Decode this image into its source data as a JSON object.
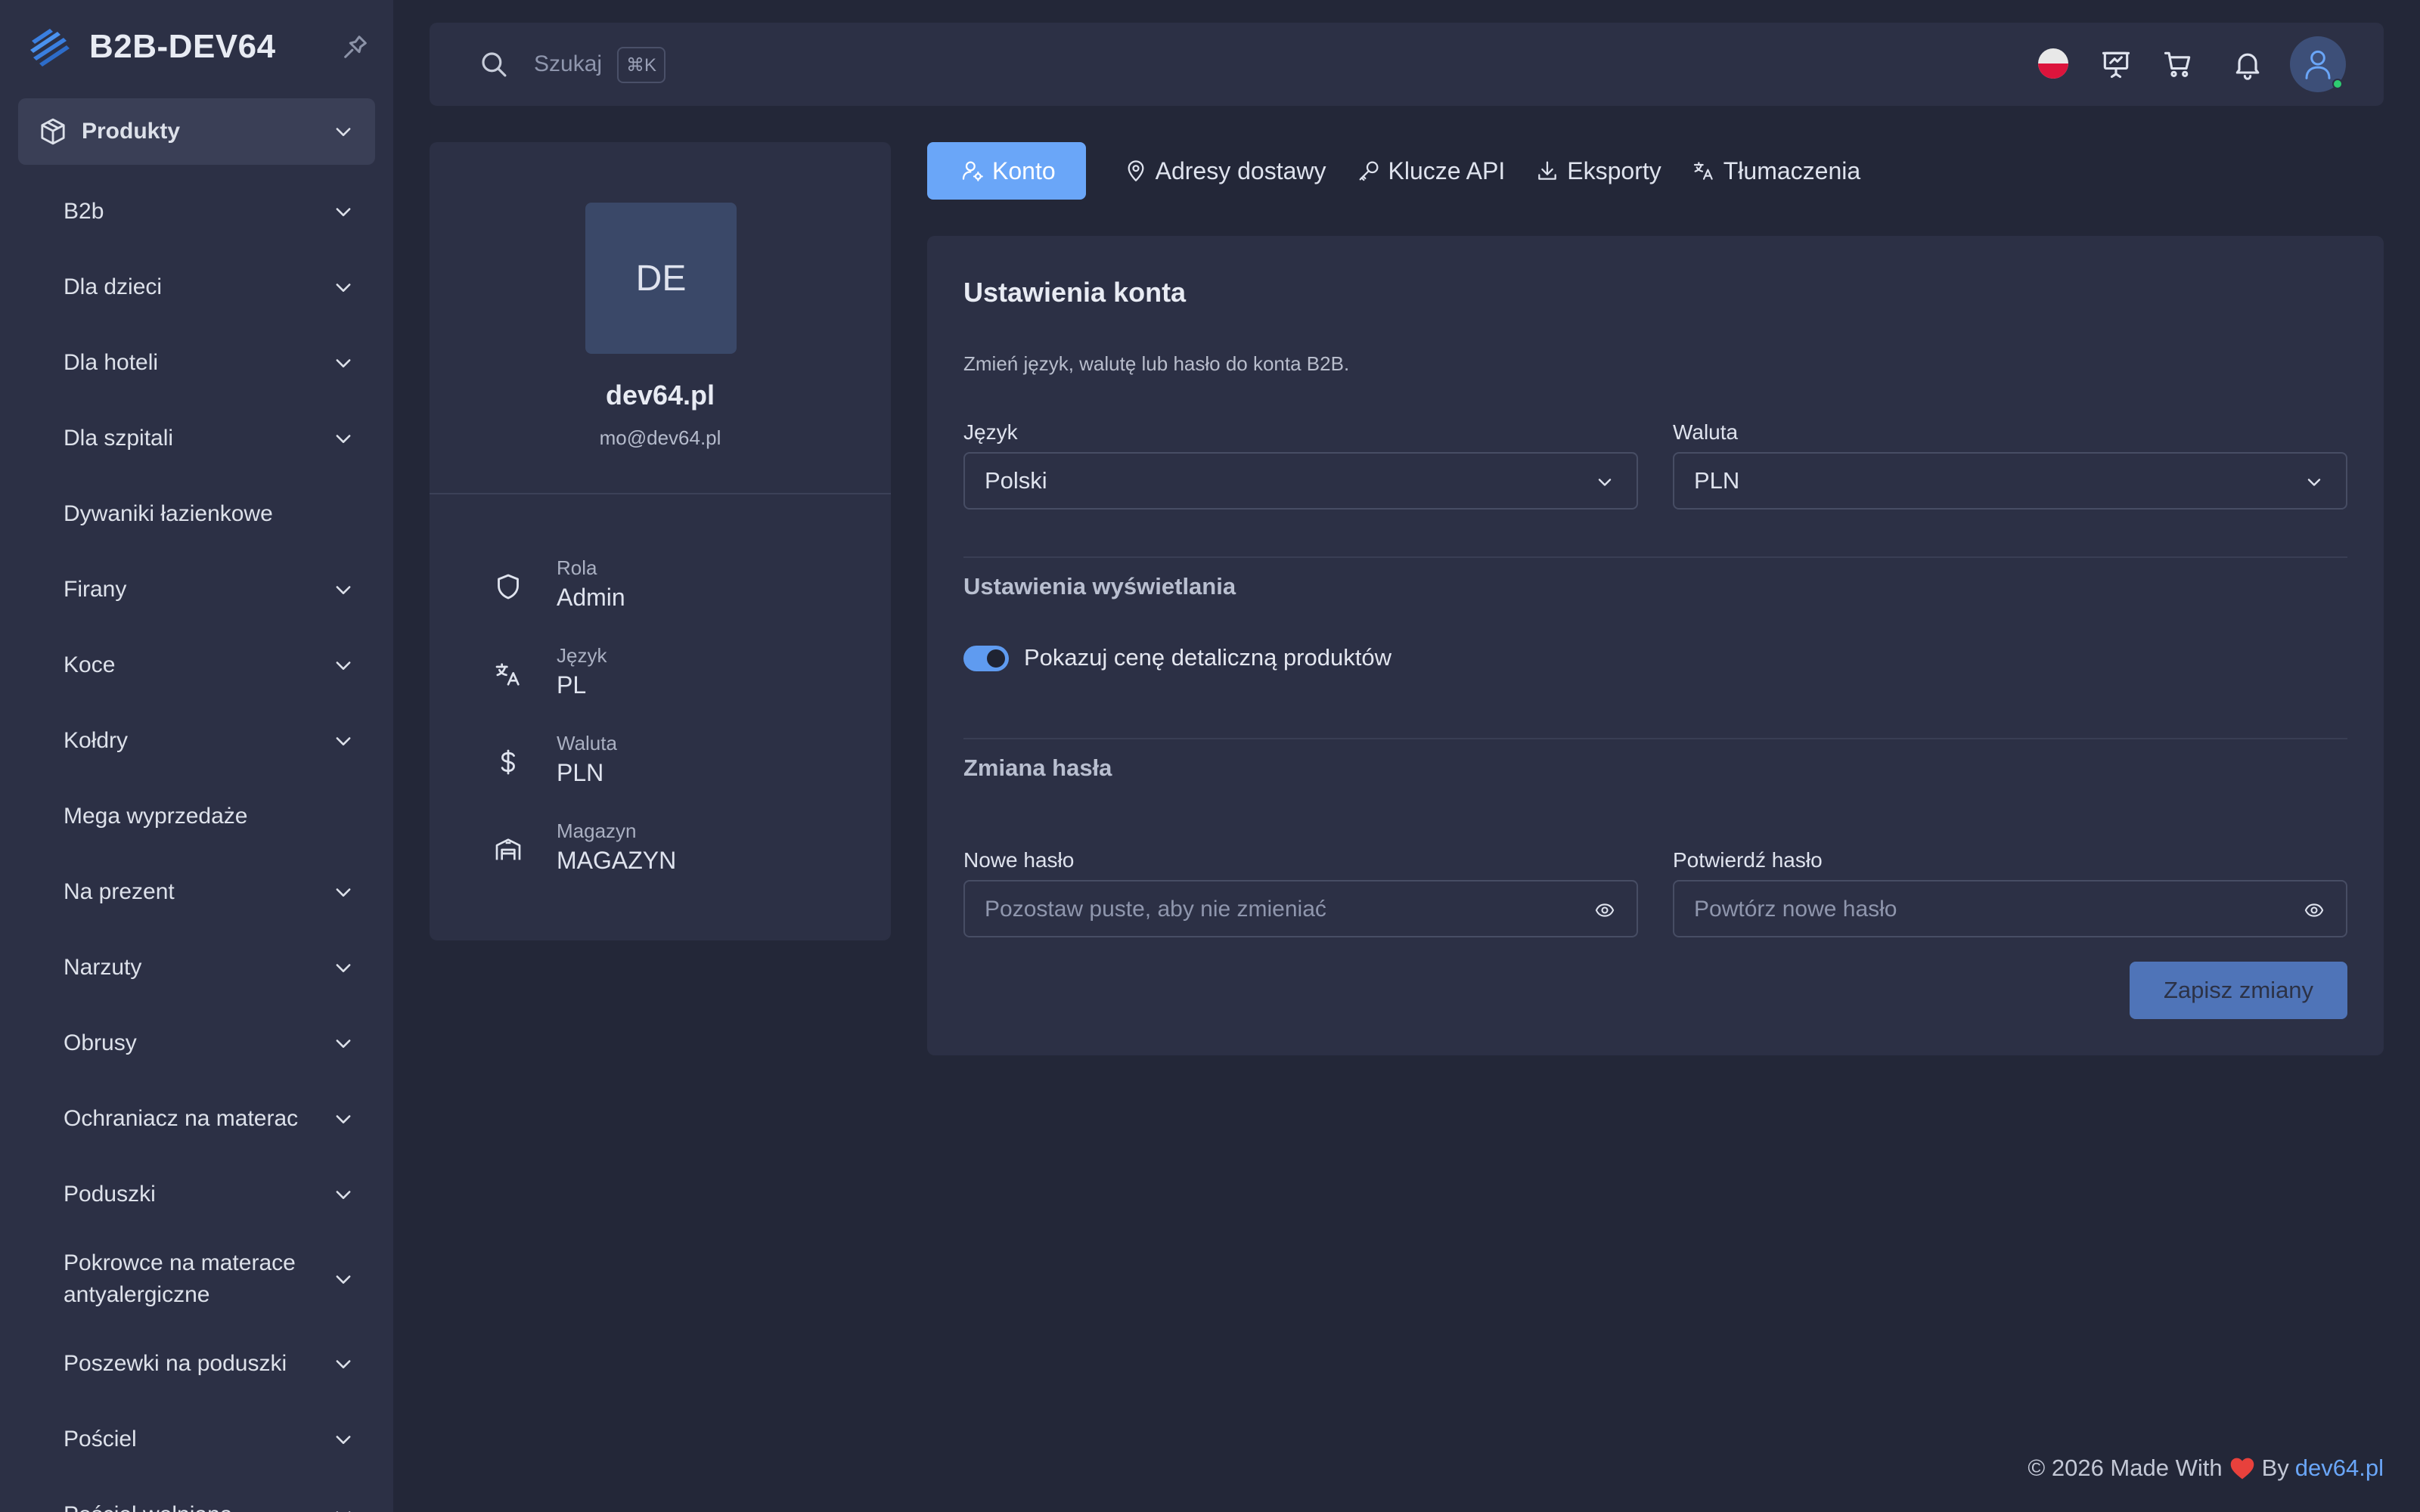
{
  "brand": {
    "name": "B2B-DEV64"
  },
  "sidebar": {
    "top_item": {
      "label": "Produkty",
      "icon": "package-icon"
    },
    "items": [
      {
        "label": "B2b",
        "has_children": true
      },
      {
        "label": "Dla dzieci",
        "has_children": true
      },
      {
        "label": "Dla hoteli",
        "has_children": true
      },
      {
        "label": "Dla szpitali",
        "has_children": true
      },
      {
        "label": "Dywaniki łazienkowe",
        "has_children": false
      },
      {
        "label": "Firany",
        "has_children": true
      },
      {
        "label": "Koce",
        "has_children": true
      },
      {
        "label": "Kołdry",
        "has_children": true
      },
      {
        "label": "Mega wyprzedaże",
        "has_children": false
      },
      {
        "label": "Na prezent",
        "has_children": true
      },
      {
        "label": "Narzuty",
        "has_children": true
      },
      {
        "label": "Obrusy",
        "has_children": true
      },
      {
        "label": "Ochraniacz na materac",
        "has_children": true
      },
      {
        "label": "Poduszki",
        "has_children": true
      },
      {
        "label": "Pokrowce na materace antyalergiczne",
        "has_children": true
      },
      {
        "label": "Poszewki na poduszki",
        "has_children": true
      },
      {
        "label": "Pościel",
        "has_children": true
      },
      {
        "label": "Pościel wełniana",
        "has_children": true
      }
    ]
  },
  "topbar": {
    "search_placeholder": "Szukaj",
    "search_shortcut": "⌘K",
    "icons": [
      "flag-pl-icon",
      "presentation-icon",
      "cart-icon",
      "bell-icon",
      "user-icon"
    ]
  },
  "profile": {
    "initials": "DE",
    "name": "dev64.pl",
    "email": "mo@dev64.pl",
    "details": [
      {
        "label": "Rola",
        "value": "Admin",
        "icon": "shield-icon"
      },
      {
        "label": "Język",
        "value": "PL",
        "icon": "translate-icon"
      },
      {
        "label": "Waluta",
        "value": "PLN",
        "icon": "dollar-icon"
      },
      {
        "label": "Magazyn",
        "value": "MAGAZYN",
        "icon": "warehouse-icon"
      }
    ]
  },
  "tabs": [
    {
      "label": "Konto",
      "icon": "user-cog-icon",
      "active": true
    },
    {
      "label": "Adresy dostawy",
      "icon": "map-pin-icon",
      "active": false
    },
    {
      "label": "Klucze API",
      "icon": "key-icon",
      "active": false
    },
    {
      "label": "Eksporty",
      "icon": "download-icon",
      "active": false
    },
    {
      "label": "Tłumaczenia",
      "icon": "translate-icon",
      "active": false
    }
  ],
  "account": {
    "title": "Ustawienia konta",
    "description": "Zmień język, walutę lub hasło do konta B2B.",
    "language_label": "Język",
    "language_value": "Polski",
    "currency_label": "Waluta",
    "currency_value": "PLN",
    "display_title": "Ustawienia wyświetlania",
    "retail_price_toggle_label": "Pokazuj cenę detaliczną produktów",
    "retail_price_toggle_on": true,
    "password_title": "Zmiana hasła",
    "new_password_label": "Nowe hasło",
    "new_password_placeholder": "Pozostaw puste, aby nie zmieniać",
    "confirm_password_label": "Potwierdź hasło",
    "confirm_password_placeholder": "Powtórz nowe hasło",
    "save_label": "Zapisz zmiany"
  },
  "footer": {
    "prefix": "© 2026 Made With",
    "by": "By",
    "link": "dev64.pl"
  },
  "colors": {
    "accent": "#6aa6f8",
    "background": "#232738",
    "panel": "#2c3045",
    "heart": "#e8413c"
  }
}
